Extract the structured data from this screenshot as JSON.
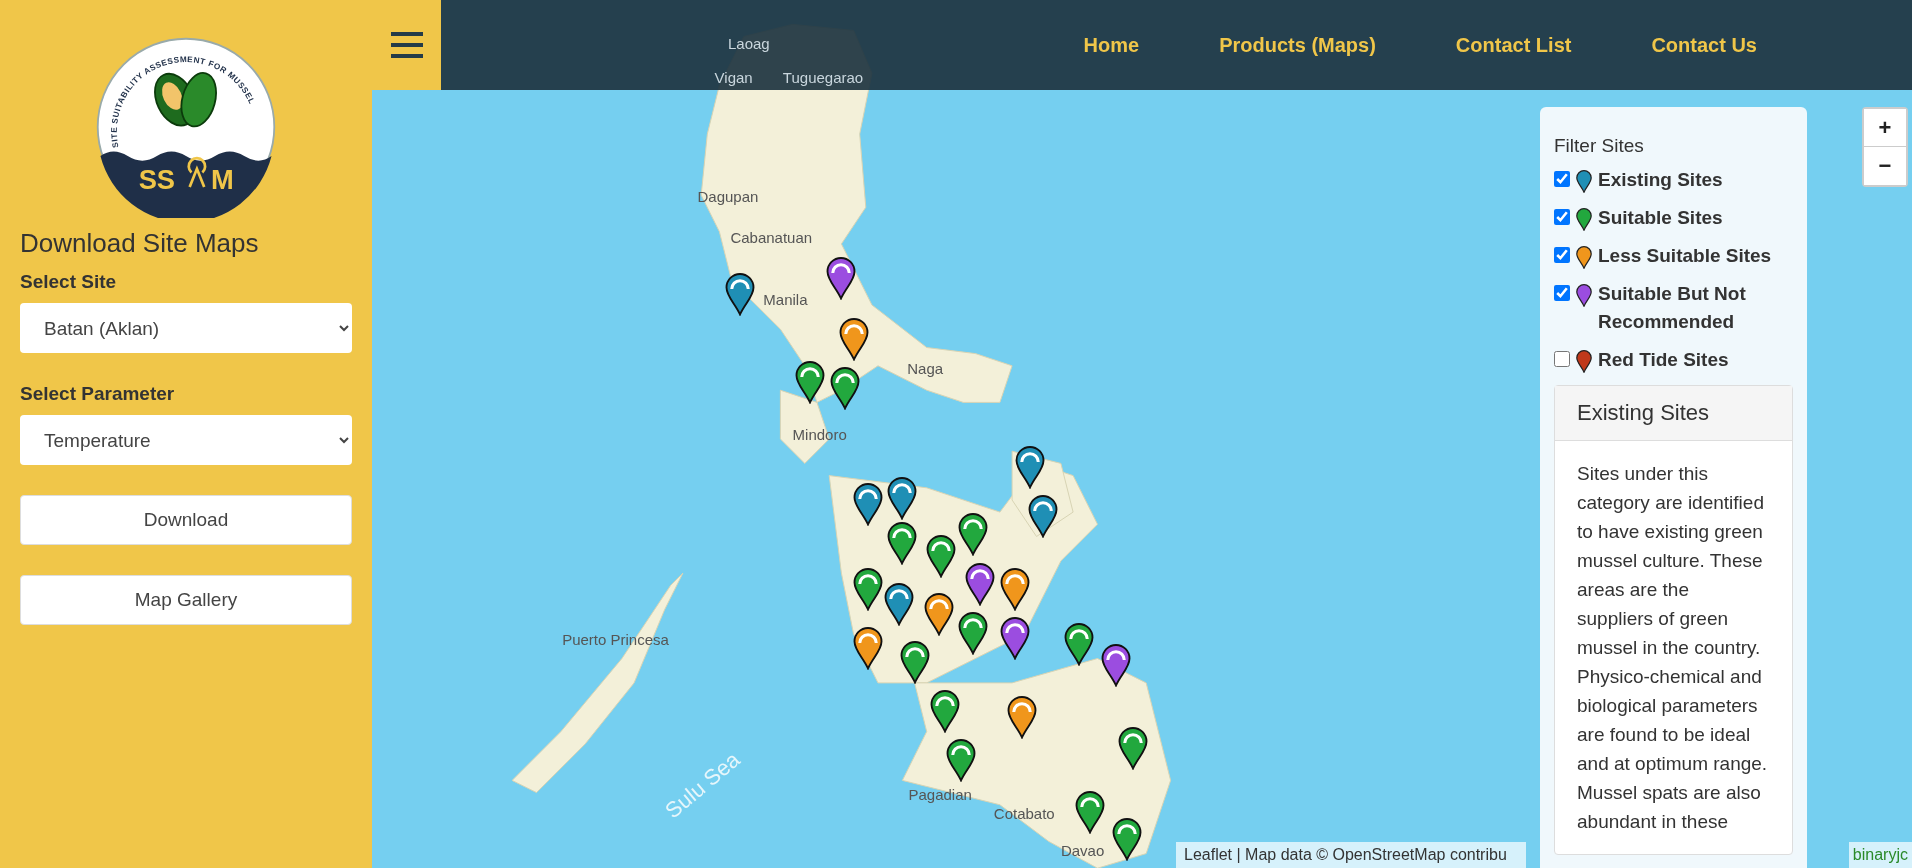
{
  "sidebar": {
    "logo": {
      "arc_text": "SITE SUITABILITY ASSESSMENT FOR MUSSEL",
      "letters_left": "SS",
      "letters_right": "M"
    },
    "title": "Download Site Maps",
    "fields": [
      {
        "label": "Select Site",
        "value": "Batan (Aklan)"
      },
      {
        "label": "Select Parameter",
        "value": "Temperature"
      }
    ],
    "buttons": [
      "Download",
      "Map Gallery"
    ]
  },
  "navbar": {
    "links": [
      "Home",
      "Products (Maps)",
      "Contact List",
      "Contact Us"
    ]
  },
  "map": {
    "labels": [
      "Laoag",
      "Vigan",
      "Tuguegarao",
      "Dagupan",
      "Cabanatuan",
      "Manila",
      "Naga",
      "Mindoro",
      "Puerto Princesa",
      "Pagadian",
      "Cotabato",
      "Davao",
      "Sulu Sea"
    ],
    "zoom_buttons": [
      "+",
      "−"
    ],
    "attribution": "Leaflet | Map data © OpenStreetMap contribu",
    "attribution_right": "binaryjc"
  },
  "filter_panel": {
    "title": "Filter Sites",
    "filters": [
      {
        "label": "Existing Sites",
        "checked": true,
        "color": "#1f8fb5"
      },
      {
        "label": "Suitable Sites",
        "checked": true,
        "color": "#22a83e"
      },
      {
        "label": "Less Suitable Sites",
        "checked": true,
        "color": "#f0961c"
      },
      {
        "label": "Suitable But Not Recommended",
        "checked": true,
        "color": "#9b4de0"
      },
      {
        "label": "Red Tide Sites",
        "checked": false,
        "color": "#c0391b"
      }
    ],
    "info_card": {
      "title": "Existing Sites",
      "body": "Sites under this category are identified to have existing green mussel culture. These areas are the suppliers of green mussel in the country. Physico-chemical and biological parameters are found to be ideal and at optimum range. Mussel spats are also abundant in these"
    }
  }
}
